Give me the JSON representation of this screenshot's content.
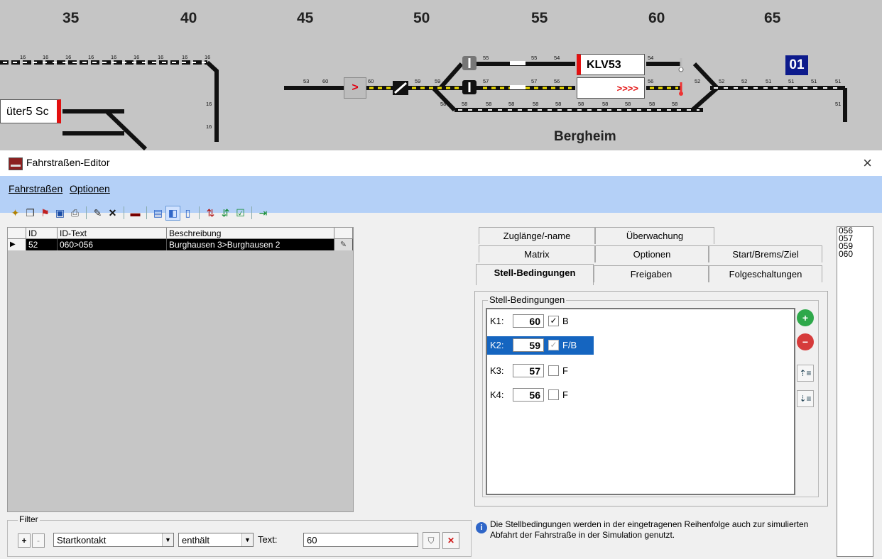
{
  "track": {
    "km_markers": [
      "35",
      "40",
      "45",
      "50",
      "55",
      "60",
      "65"
    ],
    "left_label": "üter5 Sc",
    "route_arrow": ">",
    "train_name": "KLV53",
    "train_arrows": ">>>>",
    "block_number": "01",
    "station": "Bergheim",
    "segment_numbers": [
      "16",
      "53",
      "60",
      "59",
      "55",
      "54",
      "57",
      "56",
      "58",
      "52",
      "51"
    ]
  },
  "window": {
    "title": "Fahrstraßen-Editor",
    "close": "×"
  },
  "menu": {
    "items": [
      "Fahrstraßen",
      "Optionen"
    ]
  },
  "toolbar": {
    "icons": [
      "new-icon",
      "copy-icon",
      "open-icon",
      "save-icon",
      "print-icon",
      "rename-icon",
      "delete-icon",
      "track-icon",
      "view-list-icon",
      "view-split-icon",
      "view-single-icon",
      "route-icon",
      "route-check-icon",
      "matrix-icon",
      "exit-icon"
    ]
  },
  "table": {
    "columns": [
      "ID",
      "ID-Text",
      "Beschreibung",
      ""
    ],
    "rows": [
      {
        "id": "52",
        "id_text": "060>056",
        "beschreibung": "Burghausen 3>Burghausen 2"
      }
    ]
  },
  "filter": {
    "legend": "Filter",
    "plus": "+",
    "minus": "-",
    "field": "Startkontakt",
    "operator": "enthält",
    "text_label": "Text:",
    "text_value": "60"
  },
  "tabs": {
    "row1": [
      "Zuglänge/-name",
      "Überwachung"
    ],
    "row2": [
      "Matrix",
      "Optionen",
      "Start/Brems/Ziel"
    ],
    "row3": [
      "Stell-Bedingungen",
      "Freigaben",
      "Folgeschaltungen"
    ]
  },
  "stell": {
    "legend": "Stell-Bedingungen",
    "rows": [
      {
        "label": "K1:",
        "value": "60",
        "checked": "✓",
        "flag": "B"
      },
      {
        "label": "K2:",
        "value": "59",
        "checked": "✓",
        "flag": "F/B"
      },
      {
        "label": "K3:",
        "value": "57",
        "checked": "",
        "flag": "F"
      },
      {
        "label": "K4:",
        "value": "56",
        "checked": "",
        "flag": "F"
      }
    ],
    "add": "+",
    "remove": "−"
  },
  "info": "Die Stellbedingungen werden in der eingetragenen Reihenfolge auch zur simulierten Abfahrt der Fahrstraße in der Simulation genutzt.",
  "sidelist": [
    "056",
    "057",
    "059",
    "060"
  ]
}
